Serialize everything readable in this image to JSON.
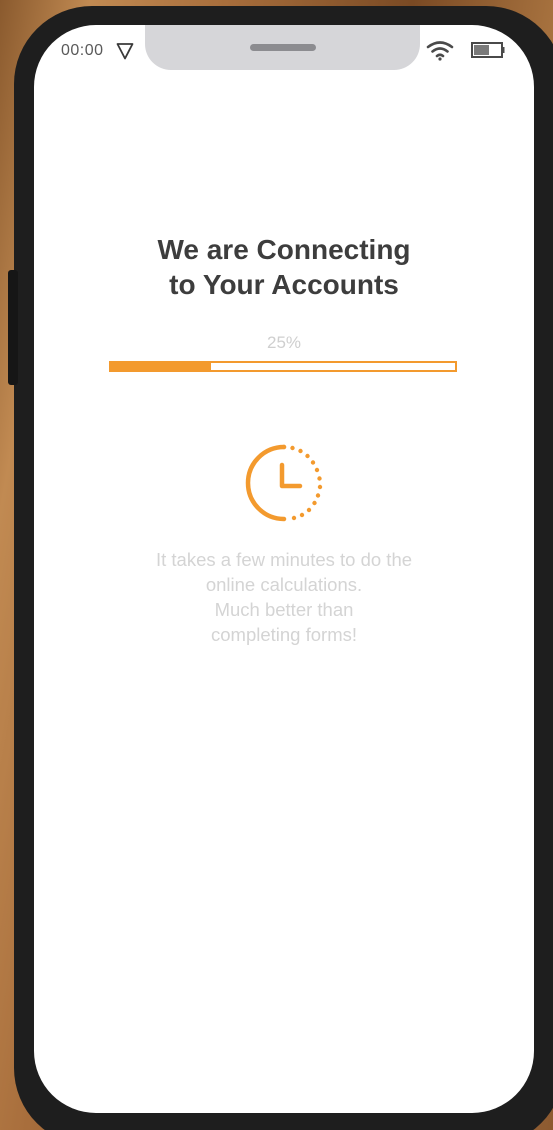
{
  "status_bar": {
    "time": "00:00",
    "icons": [
      "location-arrow-icon",
      "wifi-icon",
      "battery-icon"
    ]
  },
  "loading": {
    "title_lines": [
      "We are Connecting",
      "to Your Accounts"
    ],
    "progress_label": "25%",
    "progress_fraction": 0.29,
    "icon": "clock-icon",
    "message_lines": [
      "It takes a few minutes to do the",
      "online calculations.",
      "Much better than",
      "completing forms!"
    ]
  },
  "colors": {
    "accent": "#f39a2e",
    "title": "#3d3d3d",
    "muted_text": "#d4d4d4",
    "frame": "#1e1e1e",
    "notch": "#d6d6d9"
  }
}
